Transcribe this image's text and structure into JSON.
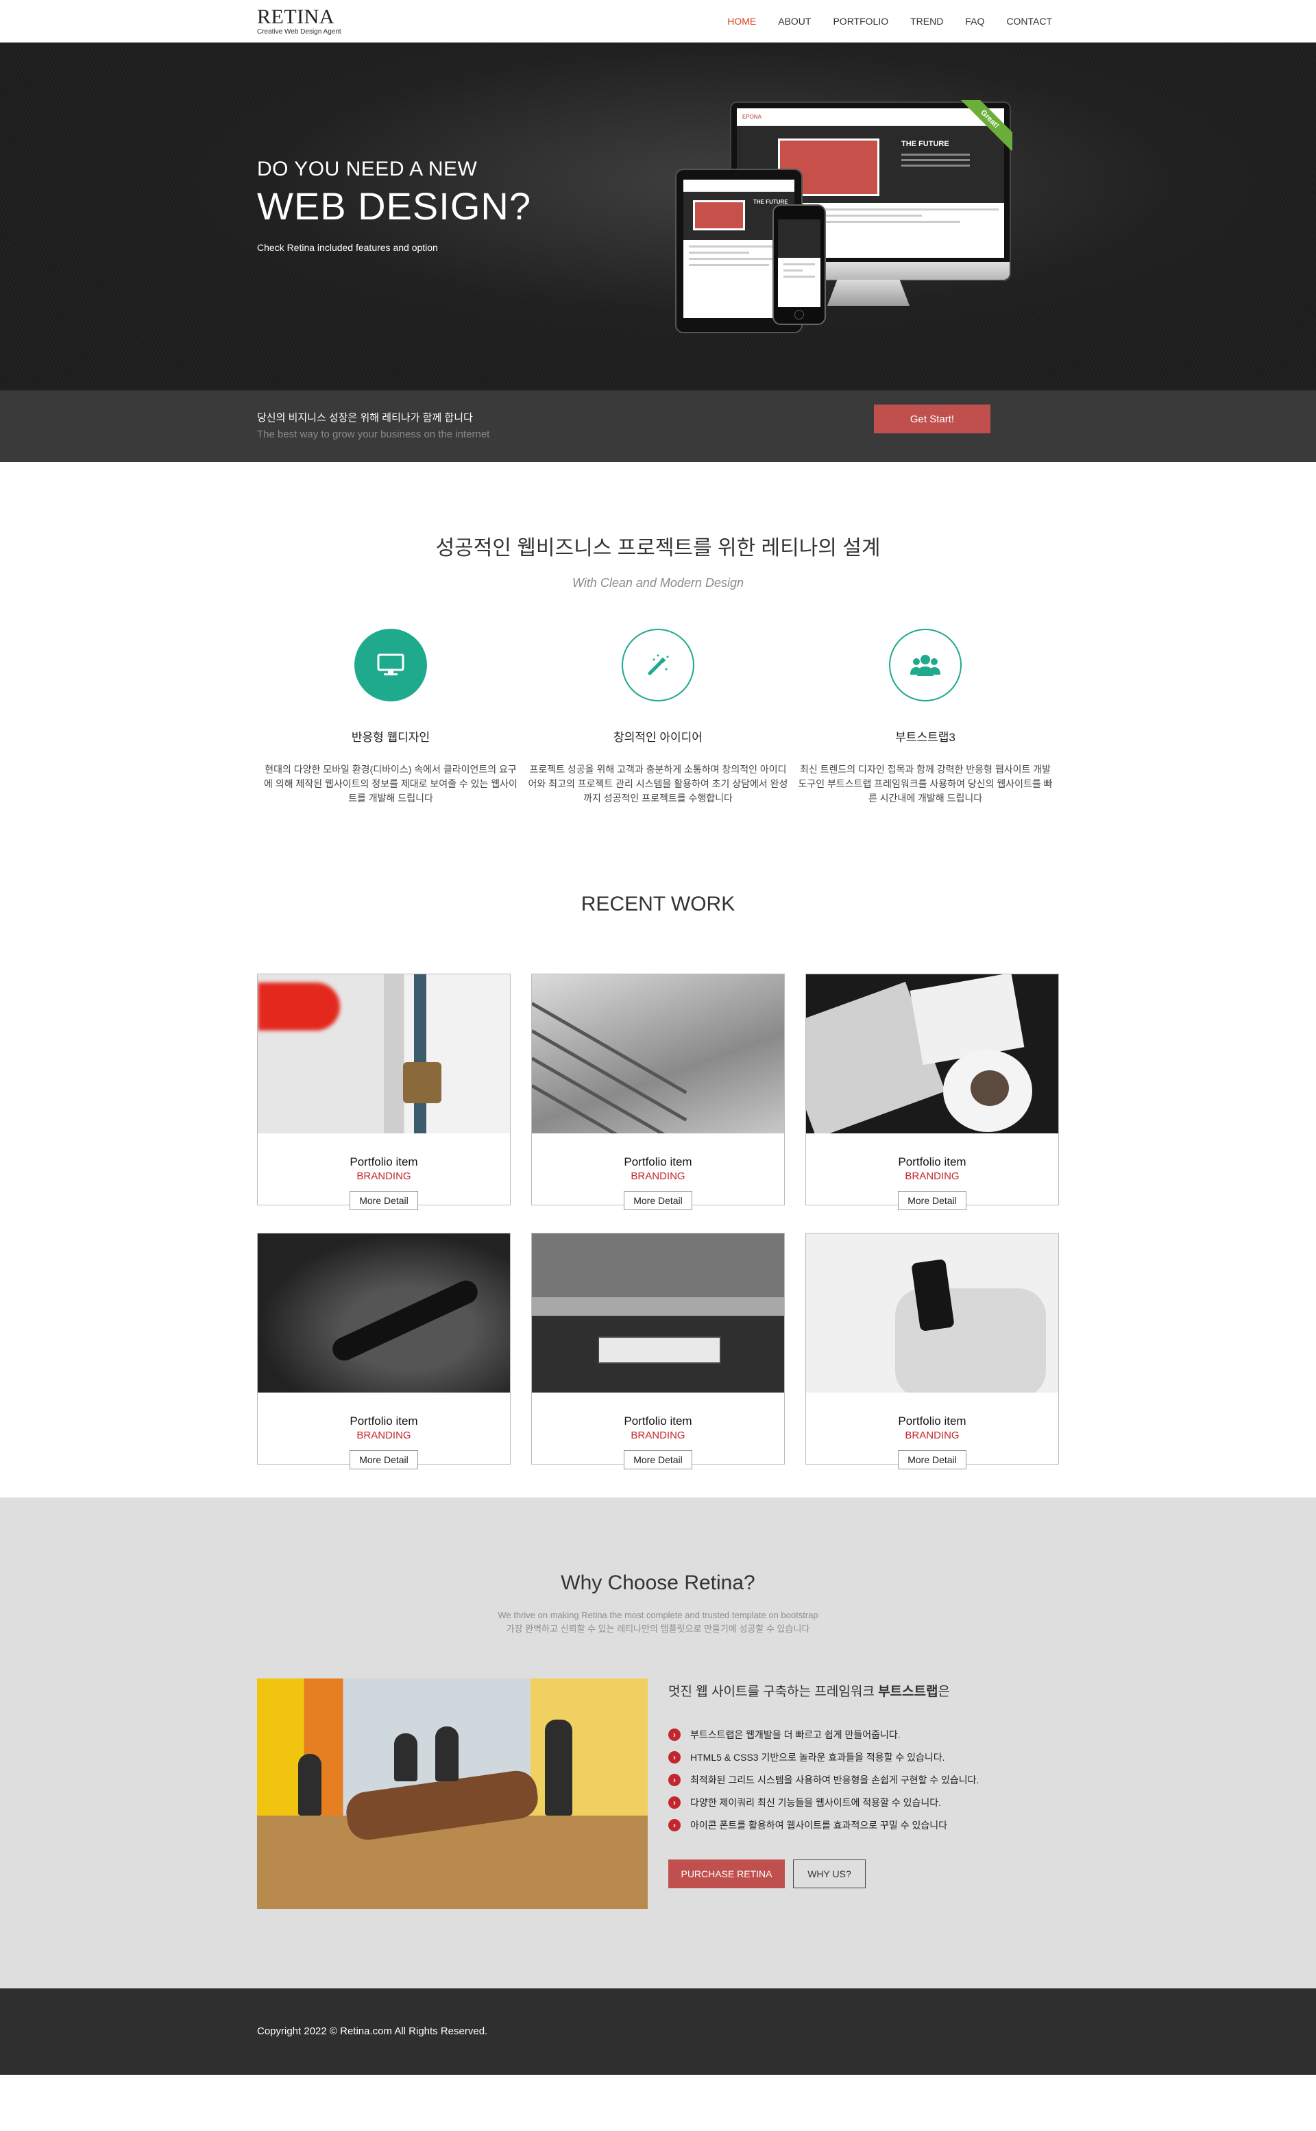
{
  "nav": {
    "logo_title": "RETINA",
    "logo_tagline": "Creative Web Design Agent",
    "items": [
      {
        "label": "HOME",
        "active": true
      },
      {
        "label": "ABOUT",
        "active": false
      },
      {
        "label": "PORTFOLIO",
        "active": false
      },
      {
        "label": "TREND",
        "active": false
      },
      {
        "label": "FAQ",
        "active": false
      },
      {
        "label": "CONTACT",
        "active": false
      }
    ],
    "active_color": "#d9411e"
  },
  "hero": {
    "line1": "DO YOU NEED A NEW",
    "line2": "WEB DESIGN?",
    "subtitle": "Check Retina included features and option",
    "mockup": {
      "ribbon": "Great!",
      "brand": "EPONA",
      "headline": "THE FUTURE"
    }
  },
  "cta": {
    "korean": "당신의 비지니스 성장은 위해 레티나가 함께 합니다",
    "english": "The best way to grow your business on the internet",
    "button": "Get Start!",
    "accent": "#c0504d"
  },
  "features": {
    "title": "성공적인 웹비즈니스 프로젝트를 위한 레티나의 설계",
    "subtitle": "With Clean and Modern Design",
    "accent": "#1faa8e",
    "items": [
      {
        "icon": "monitor-icon",
        "title": "반응형 웹디자인",
        "desc": "현대의 다양한 모바일 환경(디바이스) 속에서 클라이언트의 요구에 의해 제작된 웹사이트의 정보를 제대로 보여줄 수 있는 웹사이트를 개발해 드립니다"
      },
      {
        "icon": "magic-wand-icon",
        "title": "창의적인 아이디어",
        "desc": "프로젝트 성공을 위해 고객과 충분하게 소통하며 창의적인 아이디어와 최고의 프로젝트 관리 시스템을 활용하여 초기 상담에서 완성까지 성공적인 프로젝트를 수행합니다"
      },
      {
        "icon": "users-icon",
        "title": "부트스트랩3",
        "desc": "최신 트렌드의 디자인 접목과 함께 강력한 반응형 웹사이트 개발 도구인 부트스트랩 프레임워크를 사용하여 당신의 웹사이트를 빠른 시간내에 개발해 드립니다"
      }
    ]
  },
  "recent_work": {
    "title": "RECENT WORK",
    "items": [
      {
        "title": "Portfolio item",
        "category": "BRANDING",
        "button": "More Detail"
      },
      {
        "title": "Portfolio item",
        "category": "BRANDING",
        "button": "More Detail"
      },
      {
        "title": "Portfolio item",
        "category": "BRANDING",
        "button": "More Detail"
      },
      {
        "title": "Portfolio item",
        "category": "BRANDING",
        "button": "More Detail"
      },
      {
        "title": "Portfolio item",
        "category": "BRANDING",
        "button": "More Detail"
      },
      {
        "title": "Portfolio item",
        "category": "BRANDING",
        "button": "More Detail"
      }
    ]
  },
  "why": {
    "title": "Why Choose Retina?",
    "sub_en": "We thrive on making Retina the most complete and trusted template on bootstrap",
    "sub_ko": "가장 완벽하고 신뢰할 수 있는 레티나만의 템플릿으로 만들기에 성공할 수 있습니다",
    "heading_prefix": "멋진 웹 사이트를 구축하는 프레임워크",
    "heading_bold": "부트스트랩",
    "heading_suffix": "은",
    "list": [
      "부트스트랩은 웹개발을 더 빠르고 쉽게 만들어줍니다.",
      "HTML5 & CSS3 기반으로 놀라운 효과들을 적용할 수 있습니다.",
      "최적화된 그리드 시스템을 사용하여 반응형을 손쉽게 구현할 수 있습니다.",
      "다양한 제이쿼리 최신 기능들을 웹사이트에 적용할 수 있습니다.",
      "아이콘 폰트를 활용하여 웹사이트를 효과적으로 꾸밀 수 있습니다"
    ],
    "purchase_button": "PURCHASE RETINA",
    "why_button": "WHY US?"
  },
  "footer": {
    "copyright": "Copyright 2022 © Retina.com All Rights Reserved."
  }
}
